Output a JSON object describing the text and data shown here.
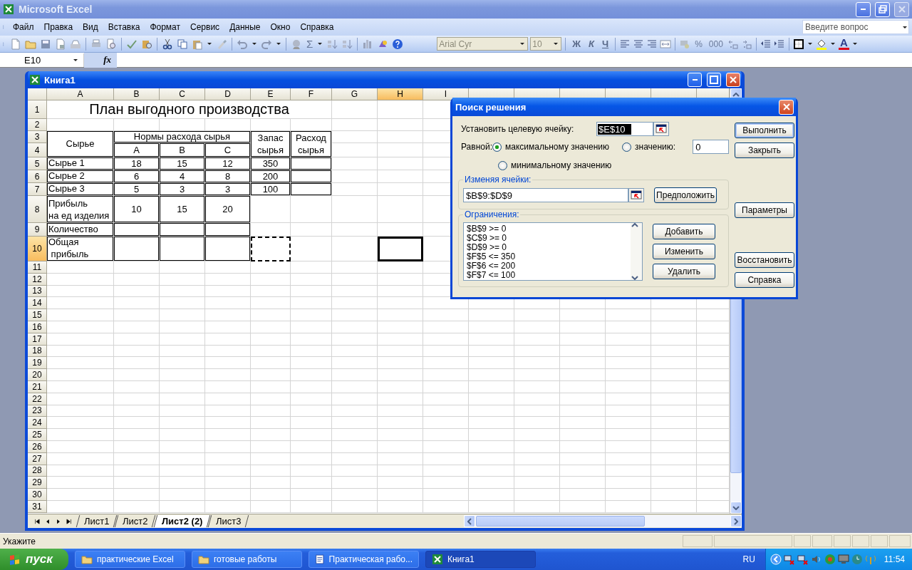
{
  "app_title": "Microsoft Excel",
  "menu": [
    "Файл",
    "Правка",
    "Вид",
    "Вставка",
    "Формат",
    "Сервис",
    "Данные",
    "Окно",
    "Справка"
  ],
  "help_search": {
    "placeholder": "Введите вопрос"
  },
  "toolbar": {
    "autosum": "Σ",
    "font": "Arial Cyr",
    "font_size": "10",
    "style_buttons": [
      "Ж",
      "К",
      "Ч"
    ],
    "number_buttons": [
      "%",
      "000"
    ],
    "font_color": "A"
  },
  "formula_bar": {
    "name_box": "E10",
    "function_label": "fx"
  },
  "workbook": {
    "title": "Книга1",
    "columns": [
      {
        "label": "A",
        "selected": false
      },
      {
        "label": "B",
        "selected": false
      },
      {
        "label": "C",
        "selected": false
      },
      {
        "label": "D",
        "selected": false
      },
      {
        "label": "E",
        "selected": false
      },
      {
        "label": "F",
        "selected": false
      },
      {
        "label": "G",
        "selected": false
      },
      {
        "label": "H",
        "selected": true
      },
      {
        "label": "I",
        "selected": false
      }
    ],
    "rows": [
      {
        "label": "1",
        "selected": false,
        "cells": [
          {
            "kind": "title",
            "text": "План выгодного производства",
            "bordered": false
          },
          {
            "kind": "merged_left"
          },
          {
            "kind": "merged_left"
          },
          {
            "kind": "merged_left"
          },
          {
            "kind": "merged_left"
          },
          {
            "kind": "merged_left"
          }
        ]
      },
      {
        "label": "2",
        "selected": false
      },
      {
        "label": "3",
        "selected": false,
        "cells": [
          {
            "kind": "header",
            "text": "Сырье",
            "bordered": true
          },
          {
            "kind": "header",
            "text": "Нормы расхода сырья",
            "bordered": true
          },
          {
            "kind": "merged_left"
          },
          {
            "kind": "merged_left"
          },
          {
            "kind": "header",
            "text": "Запас\nсырья",
            "bordered": true
          },
          {
            "kind": "header",
            "text": "Расход\nсырья",
            "bordered": true
          }
        ]
      },
      {
        "label": "4",
        "selected": false,
        "cells": [
          {
            "kind": "merged_up"
          },
          {
            "kind": "number",
            "text": "A",
            "bordered": true
          },
          {
            "kind": "number",
            "text": "B",
            "bordered": true
          },
          {
            "kind": "number",
            "text": "C",
            "bordered": true
          },
          {
            "kind": "merged_up"
          },
          {
            "kind": "merged_up"
          }
        ]
      },
      {
        "label": "5",
        "selected": false,
        "cells": [
          {
            "kind": "label",
            "text": "Сырье 1",
            "bordered": true
          },
          {
            "kind": "number",
            "text": "18",
            "bordered": true
          },
          {
            "kind": "number",
            "text": "15",
            "bordered": true
          },
          {
            "kind": "number",
            "text": "12",
            "bordered": true
          },
          {
            "kind": "number",
            "text": "350",
            "bordered": true
          },
          {
            "kind": "empty",
            "bordered": true
          }
        ]
      },
      {
        "label": "6",
        "selected": false,
        "cells": [
          {
            "kind": "label",
            "text": "Сырье 2",
            "bordered": true
          },
          {
            "kind": "number",
            "text": "6",
            "bordered": true
          },
          {
            "kind": "number",
            "text": "4",
            "bordered": true
          },
          {
            "kind": "number",
            "text": "8",
            "bordered": true
          },
          {
            "kind": "number",
            "text": "200",
            "bordered": true
          },
          {
            "kind": "empty",
            "bordered": true
          }
        ]
      },
      {
        "label": "7",
        "selected": false,
        "cells": [
          {
            "kind": "label",
            "text": "Сырье 3",
            "bordered": true
          },
          {
            "kind": "number",
            "text": "5",
            "bordered": true
          },
          {
            "kind": "number",
            "text": "3",
            "bordered": true
          },
          {
            "kind": "number",
            "text": "3",
            "bordered": true
          },
          {
            "kind": "number",
            "text": "100",
            "bordered": true
          },
          {
            "kind": "empty",
            "bordered": true
          }
        ]
      },
      {
        "label": "8",
        "selected": false,
        "cells": [
          {
            "kind": "label",
            "text": "Прибыль\nна ед изделия",
            "bordered": true
          },
          {
            "kind": "number",
            "text": "10",
            "bordered": true
          },
          {
            "kind": "number",
            "text": "15",
            "bordered": true
          },
          {
            "kind": "number",
            "text": "20",
            "bordered": true
          }
        ]
      },
      {
        "label": "9",
        "selected": false,
        "cells": [
          {
            "kind": "label",
            "text": "Количество",
            "bordered": true
          },
          {
            "kind": "empty",
            "bordered": true
          },
          {
            "kind": "empty",
            "bordered": true
          },
          {
            "kind": "empty",
            "bordered": true
          }
        ]
      },
      {
        "label": "10",
        "selected": true,
        "cells": [
          {
            "kind": "label",
            "text": "Общая\n прибыль",
            "bordered": true
          },
          {
            "kind": "empty",
            "bordered": true
          },
          {
            "kind": "empty",
            "bordered": true
          },
          {
            "kind": "empty",
            "bordered": true
          },
          {
            "kind": "marquee"
          },
          {
            "kind": "empty",
            "bordered": false
          },
          {
            "kind": "empty",
            "bordered": false
          },
          {
            "kind": "active"
          }
        ]
      },
      {
        "label": "11",
        "selected": false
      },
      {
        "label": "12",
        "selected": false
      },
      {
        "label": "13",
        "selected": false
      },
      {
        "label": "14",
        "selected": false
      },
      {
        "label": "15",
        "selected": false
      },
      {
        "label": "16",
        "selected": false
      },
      {
        "label": "17",
        "selected": false
      },
      {
        "label": "18",
        "selected": false
      },
      {
        "label": "19",
        "selected": false
      },
      {
        "label": "20",
        "selected": false
      },
      {
        "label": "21",
        "selected": false
      },
      {
        "label": "22",
        "selected": false
      },
      {
        "label": "23",
        "selected": false
      },
      {
        "label": "24",
        "selected": false
      },
      {
        "label": "25",
        "selected": false
      },
      {
        "label": "26",
        "selected": false
      },
      {
        "label": "27",
        "selected": false
      },
      {
        "label": "28",
        "selected": false
      },
      {
        "label": "29",
        "selected": false
      },
      {
        "label": "30",
        "selected": false
      },
      {
        "label": "31",
        "selected": false
      }
    ],
    "sheet_tabs": [
      {
        "label": "Лист1",
        "selected": false
      },
      {
        "label": "Лист2",
        "selected": false
      },
      {
        "label": "Лист2 (2)",
        "selected": true
      },
      {
        "label": "Лист3",
        "selected": false
      }
    ]
  },
  "solver": {
    "title": "Поиск решения",
    "target_label": "Установить целевую ячейку:",
    "target_value": "$E$10",
    "equal_label": "Равной:",
    "options": [
      {
        "label": "максимальному значению",
        "selected": true
      },
      {
        "label": "значению:",
        "selected": false
      },
      {
        "label": "минимальному значению",
        "selected": false
      }
    ],
    "value": "0",
    "changing_label": "Изменяя ячейки:",
    "changing_value": "$B$9:$D$9",
    "guess_button": "Предположить",
    "constraints_label": "Ограничения:",
    "constraints": [
      "$B$9 >= 0",
      "$C$9 >= 0",
      "$D$9 >= 0",
      "$F$5 <= 350",
      "$F$6 <= 200",
      "$F$7 <= 100"
    ],
    "constraint_buttons": [
      "Добавить",
      "Изменить",
      "Удалить"
    ],
    "buttons": [
      {
        "label": "Выполнить",
        "default": true
      },
      {
        "label": "Закрыть",
        "default": false
      },
      {
        "label": "Параметры",
        "default": false
      },
      {
        "label": "Восстановить",
        "default": false
      },
      {
        "label": "Справка",
        "default": false
      }
    ]
  },
  "status_bar": {
    "text": "Укажите"
  },
  "taskbar": {
    "start": "пуск",
    "tasks": [
      {
        "label": "практические Excel",
        "kind": "folder",
        "selected": false
      },
      {
        "label": "готовые работы",
        "kind": "folder",
        "selected": false
      },
      {
        "label": "Практическая рабо...",
        "kind": "word",
        "selected": false
      },
      {
        "label": "Книга1",
        "kind": "excel",
        "selected": true
      }
    ],
    "language": "RU",
    "clock": "11:54"
  }
}
